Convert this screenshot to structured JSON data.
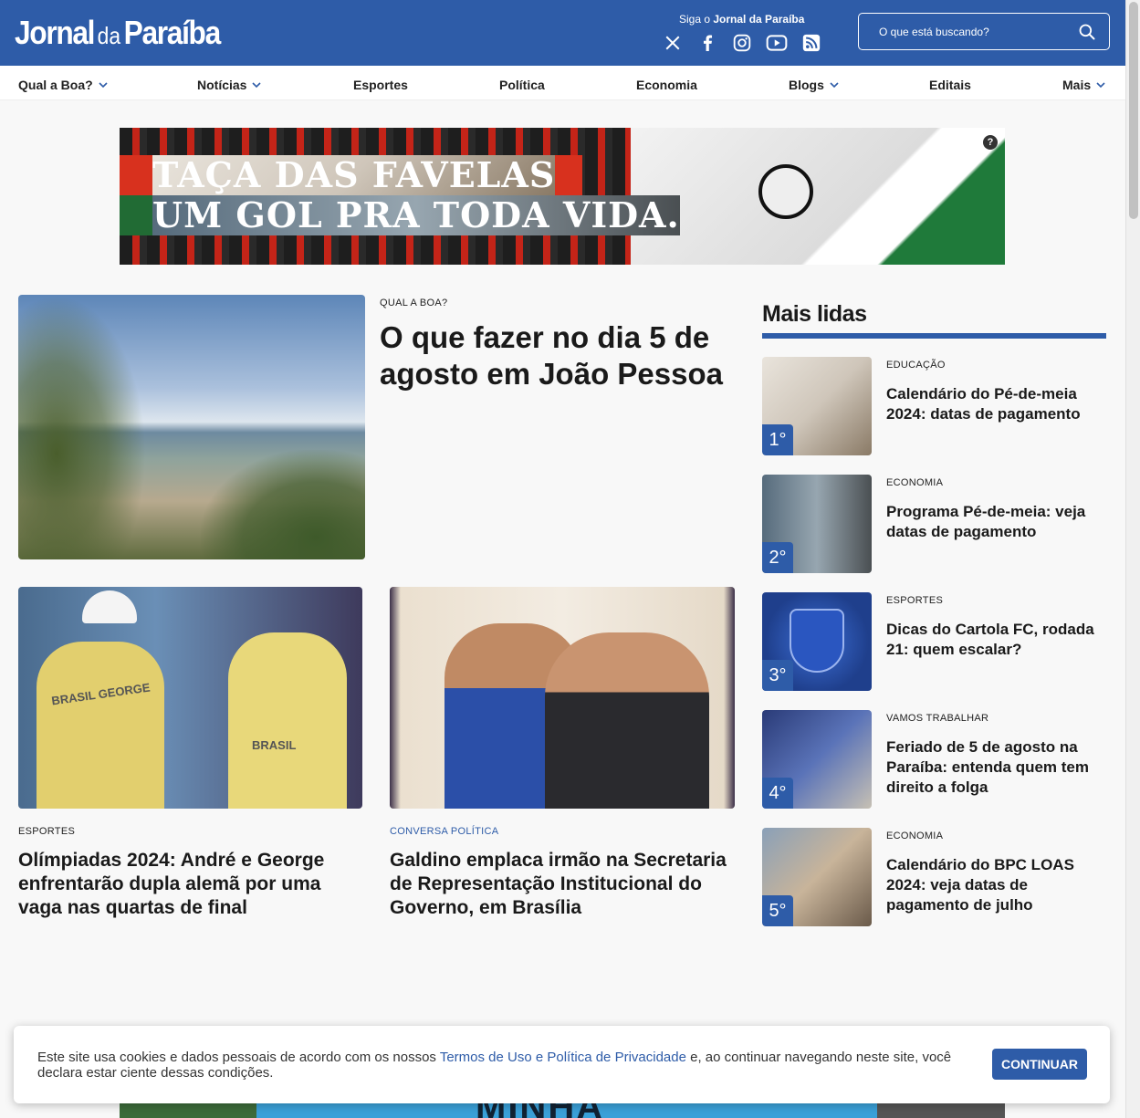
{
  "header": {
    "logo_main": "Jornal",
    "logo_da": "da",
    "logo_end": "Paraíba",
    "follow_prefix": "Siga o",
    "follow_name": "Jornal da Paraíba",
    "socials": [
      "x-icon",
      "facebook-icon",
      "instagram-icon",
      "youtube-icon",
      "rss-icon"
    ],
    "search_placeholder": "O que está buscando?"
  },
  "nav": [
    {
      "label": "Qual a Boa?",
      "dropdown": true
    },
    {
      "label": "Notícias",
      "dropdown": true
    },
    {
      "label": "Esportes",
      "dropdown": false
    },
    {
      "label": "Política",
      "dropdown": false
    },
    {
      "label": "Economia",
      "dropdown": false
    },
    {
      "label": "Blogs",
      "dropdown": true
    },
    {
      "label": "Editais",
      "dropdown": false
    },
    {
      "label": "Mais",
      "dropdown": true
    }
  ],
  "ad": {
    "line1": "TAÇA DAS FAVELAS",
    "line2": "UM GOL PRA TODA VIDA.",
    "info": "?"
  },
  "lead": {
    "kicker": "QUAL A BOA?",
    "title": "O que fazer no dia 5 de agosto em João Pessoa"
  },
  "stories": [
    {
      "kicker": "ESPORTES",
      "title": "Olímpiadas 2024: André e George enfrentarão dupla alemã por uma vaga nas quartas de final",
      "jersey1": "BRASIL GEORGE",
      "jersey2": "BRASIL"
    },
    {
      "kicker": "CONVERSA POLÍTICA",
      "title": "Galdino emplaca irmão na Secretaria de Representação Institucional do Governo, em Brasília"
    }
  ],
  "mais_lidas": {
    "heading": "Mais lidas",
    "items": [
      {
        "rank": "1°",
        "category": "EDUCAÇÃO",
        "title": "Calendário do Pé-de-meia 2024: datas de pagamento"
      },
      {
        "rank": "2°",
        "category": "ECONOMIA",
        "title": "Programa Pé-de-meia: veja datas de pagamento"
      },
      {
        "rank": "3°",
        "category": "ESPORTES",
        "title": "Dicas do Cartola FC, rodada 21: quem escalar?"
      },
      {
        "rank": "4°",
        "category": "VAMOS TRABALHAR",
        "title": "Feriado de 5 de agosto na Paraíba: entenda quem tem direito a folga"
      },
      {
        "rank": "5°",
        "category": "ECONOMIA",
        "title": "Calendário do BPC LOAS 2024: veja datas de pagamento de julho"
      }
    ]
  },
  "bottom_ad": {
    "text": "MINHA"
  },
  "cookie": {
    "text_before": "Este site usa cookies e dados pessoais de acordo com os nossos ",
    "link": "Termos de Uso e Política de Privacidade",
    "text_after": " e, ao continuar navegando neste site, você declara estar ciente dessas condições.",
    "button": "CONTINUAR"
  },
  "colors": {
    "brand": "#2e5ca8"
  }
}
